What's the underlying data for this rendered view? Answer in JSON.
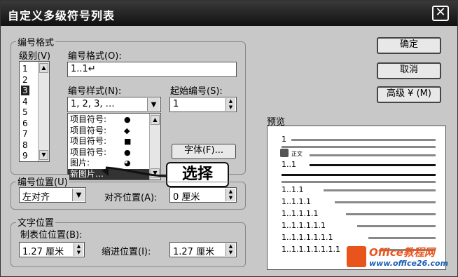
{
  "dialog": {
    "title": "自定义多级符号列表",
    "close_glyph": "✕"
  },
  "numbering_format_group": {
    "label": "编号格式",
    "level_label": "级别(V)",
    "levels": [
      "1",
      "2",
      "3",
      "4",
      "5",
      "6",
      "7",
      "8",
      "9"
    ],
    "selected_level": "3",
    "format_label": "编号格式(O):",
    "format_value": "1..1↵",
    "style_label": "编号样式(N):",
    "style_value": "1, 2, 3, …",
    "start_label": "起始编号(S):",
    "start_value": "1",
    "style_options": [
      {
        "label": "项目符号:",
        "symbol": "●"
      },
      {
        "label": "项目符号:",
        "symbol": "◆"
      },
      {
        "label": "项目符号:",
        "symbol": "■"
      },
      {
        "label": "项目符号:",
        "symbol": "●"
      },
      {
        "label": "图片:",
        "symbol": "◕"
      },
      {
        "label": "新图片…",
        "symbol": ""
      }
    ],
    "font_button": "字体(F)..."
  },
  "number_position_group": {
    "label": "编号位置(U)",
    "align_value": "左对齐",
    "align_at_label": "对齐位置(A):",
    "align_at_value": "0 厘米"
  },
  "text_position_group": {
    "label": "文字位置",
    "tab_label": "制表位位置(B):",
    "tab_value": "1.27 厘米",
    "indent_label": "缩进位置(I):",
    "indent_value": "1.27 厘米"
  },
  "buttons": {
    "ok": "确定",
    "cancel": "取消",
    "advanced": "高级 ¥ (M)"
  },
  "preview": {
    "label": "预览",
    "lines": [
      "1",
      "1..1",
      "1..1.1",
      "1..1.1.1",
      "1..1.1.1.1",
      "1..1.1.1.1.1",
      "1..1.1.1.1.1.1",
      "1..1.1.1.1.1.1.1"
    ],
    "body_text": "正文"
  },
  "callout": {
    "text": "选择"
  },
  "watermark": {
    "brand": "Office教程网",
    "url": "www.office26.com"
  }
}
